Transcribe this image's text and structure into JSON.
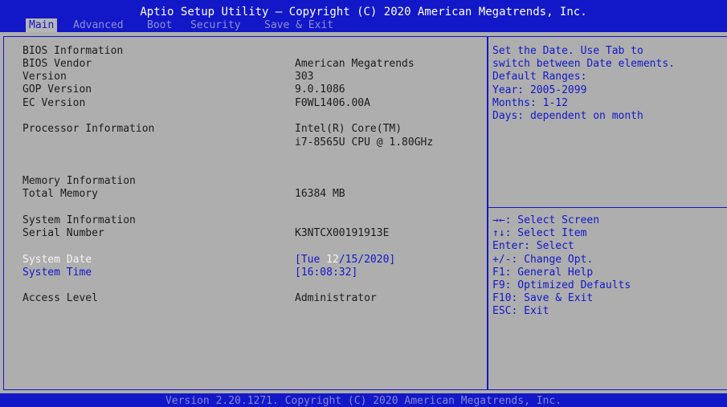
{
  "header": {
    "title": "Aptio Setup Utility – Copyright (C) 2020 American Megatrends, Inc.",
    "tabs": [
      {
        "label": "Main",
        "active": true
      },
      {
        "label": "Advanced",
        "active": false
      },
      {
        "label": "Boot",
        "active": false
      },
      {
        "label": "Security",
        "active": false
      },
      {
        "label": "Save & Exit",
        "active": false
      }
    ]
  },
  "main": {
    "bios_info": {
      "heading": "BIOS Information",
      "vendor_label": "BIOS Vendor",
      "vendor_value": "American Megatrends",
      "version_label": "Version",
      "version_value": "303",
      "gop_label": "GOP Version",
      "gop_value": "9.0.1086",
      "ec_label": "EC Version",
      "ec_value": "F0WL1406.00A"
    },
    "processor": {
      "label": "Processor Information",
      "value_line1": "Intel(R) Core(TM)",
      "value_line2": "i7-8565U CPU @ 1.80GHz"
    },
    "memory": {
      "heading": "Memory Information",
      "total_label": "Total Memory",
      "total_value": "16384 MB"
    },
    "system": {
      "heading": "System Information",
      "serial_label": "Serial Number",
      "serial_value": "K3NTCX00191913E",
      "date_label": "System Date",
      "date_value_prefix": "[Tue ",
      "date_value_month": "12",
      "date_value_suffix": "/15/2020]",
      "time_label": "System Time",
      "time_value": "[16:08:32]"
    },
    "access": {
      "label": "Access Level",
      "value": "Administrator"
    }
  },
  "help": {
    "lines": [
      "Set the Date. Use Tab to",
      "switch between Date elements.",
      "Default Ranges:",
      "Year: 2005-2099",
      "Months: 1-12",
      "Days: dependent on month"
    ]
  },
  "keys": [
    {
      "key": "→←",
      "desc": ": Select Screen"
    },
    {
      "key": "↑↓",
      "desc": ": Select Item"
    },
    {
      "key": "",
      "desc": "Enter: Select"
    },
    {
      "key": "",
      "desc": "+/-: Change Opt."
    },
    {
      "key": "",
      "desc": "F1: General Help"
    },
    {
      "key": "",
      "desc": "F9: Optimized Defaults"
    },
    {
      "key": "",
      "desc": "F10: Save & Exit"
    },
    {
      "key": "",
      "desc": "ESC: Exit"
    }
  ],
  "footer": {
    "text": "Version 2.20.1271. Copyright (C) 2020 American Megatrends, Inc."
  },
  "colors": {
    "accent": "#1218c8",
    "background": "#aeaeae",
    "highlight": "#f4f4f4"
  }
}
